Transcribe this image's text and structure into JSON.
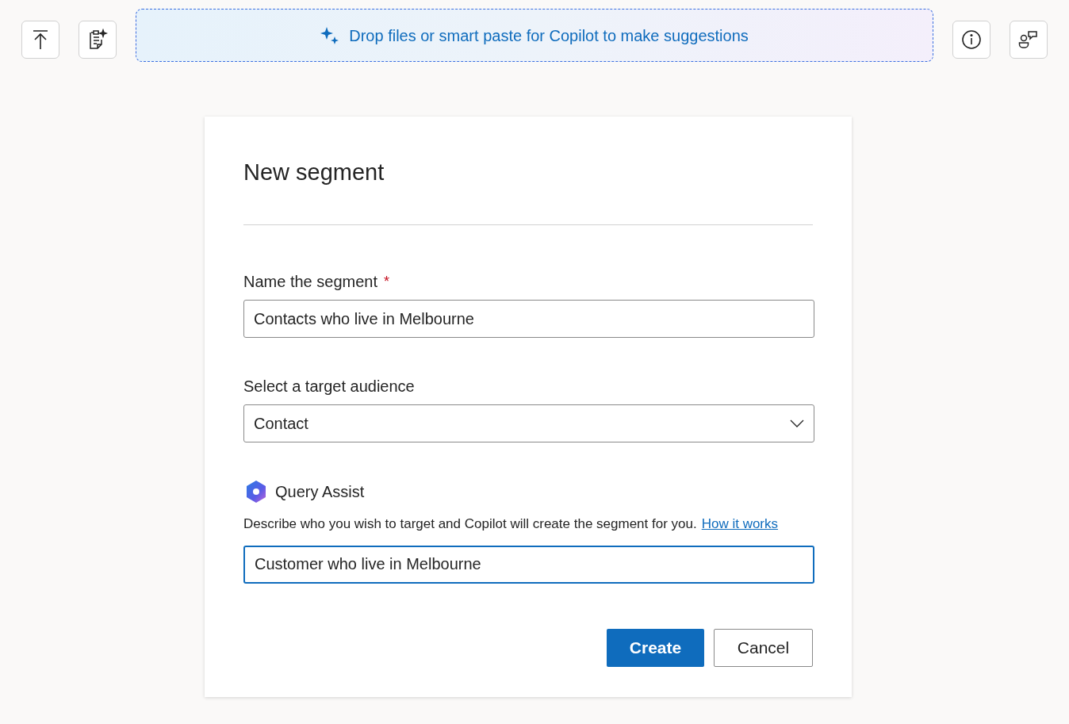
{
  "toolbar": {
    "drop_zone": {
      "label": "Drop files or smart paste for Copilot to make suggestions"
    }
  },
  "form": {
    "title": "New segment",
    "name_field": {
      "label": "Name the segment",
      "required_mark": "*",
      "value": "Contacts who live in Melbourne"
    },
    "audience_field": {
      "label": "Select a target audience",
      "value": "Contact"
    },
    "query_assist": {
      "title": "Query Assist",
      "description": "Describe who you wish to target and Copilot will create the segment for you.",
      "link": "How it works",
      "value": "Customer who live in Melbourne",
      "focused": true
    },
    "buttons": [
      {
        "label": "Create",
        "kind": "primary"
      },
      {
        "label": "Cancel",
        "kind": "secondary"
      }
    ]
  }
}
